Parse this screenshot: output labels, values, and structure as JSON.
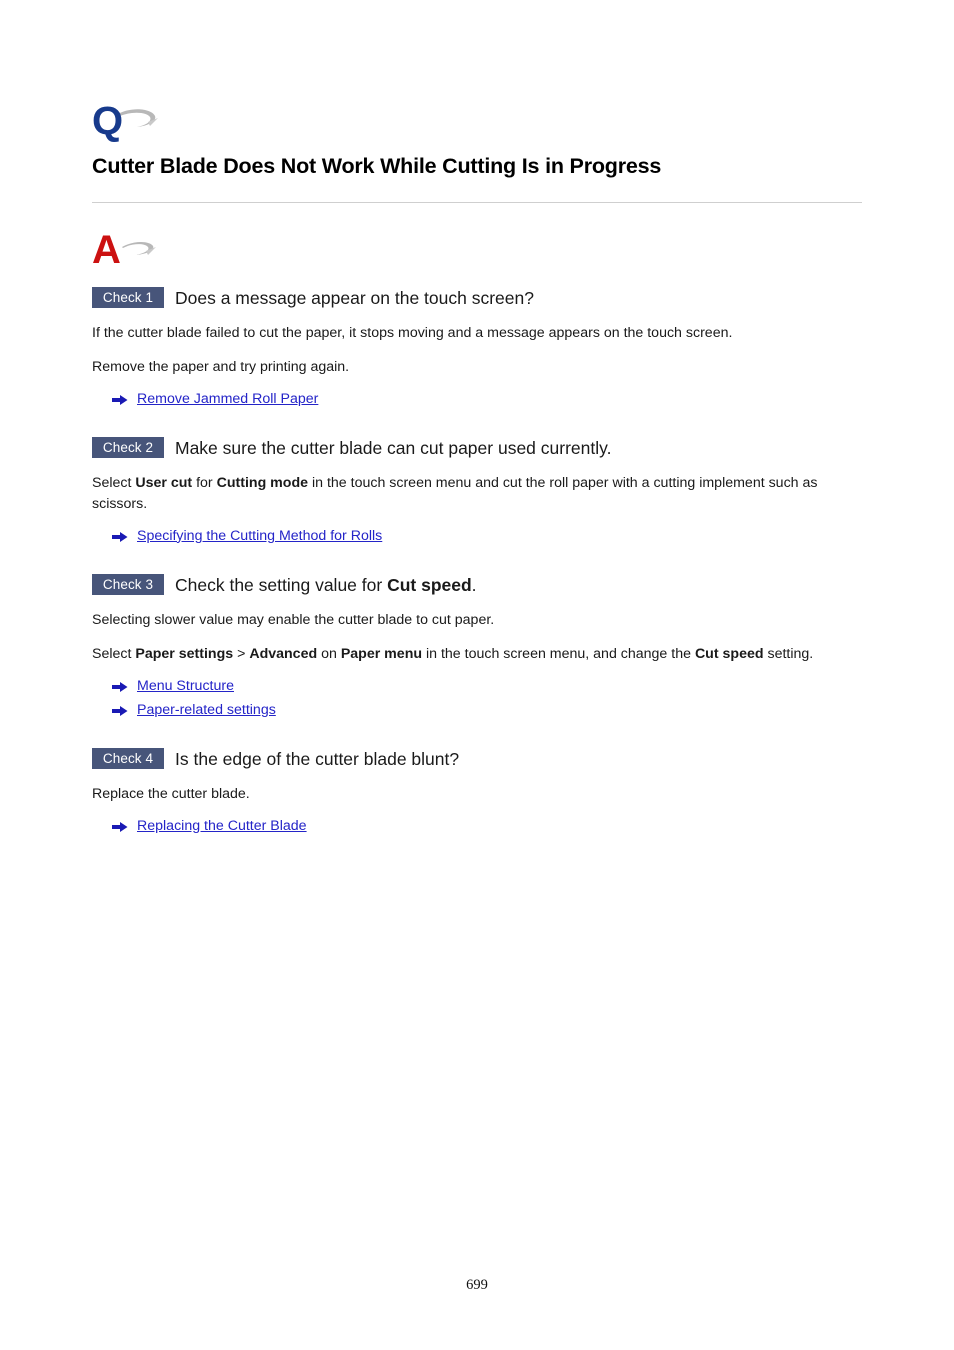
{
  "document": {
    "qa_icon_q": "question-emblem-q",
    "qa_icon_a": "answer-emblem-a",
    "title": "Cutter Blade Does Not Work While Cutting Is in Progress",
    "page_number": "699"
  },
  "colors": {
    "badge_background": "#47557a",
    "badge_text": "#ffffff",
    "link": "#2424c8",
    "q_emblem": "#173a8c",
    "a_emblem": "#cc1111",
    "swoosh": "#b5b5b5",
    "divider": "#cfcfcf"
  },
  "checks": [
    {
      "badge": "Check 1",
      "title_parts": [
        {
          "text": "Does a message appear on the touch screen?",
          "bold": false
        }
      ],
      "paragraphs": [
        [
          {
            "text": "If the cutter blade failed to cut the paper, it stops moving and a message appears on the touch screen.",
            "bold": false
          }
        ],
        [
          {
            "text": "Remove the paper and try printing again.",
            "bold": false
          }
        ]
      ],
      "links": [
        {
          "label": "Remove Jammed Roll Paper",
          "icon": "arrow-right-icon"
        }
      ]
    },
    {
      "badge": "Check 2",
      "title_parts": [
        {
          "text": "Make sure the cutter blade can cut paper used currently.",
          "bold": false
        }
      ],
      "paragraphs": [
        [
          {
            "text": "Select ",
            "bold": false
          },
          {
            "text": "User cut",
            "bold": true
          },
          {
            "text": " for ",
            "bold": false
          },
          {
            "text": "Cutting mode",
            "bold": true
          },
          {
            "text": " in the touch screen menu and cut the roll paper with a cutting implement such as scissors.",
            "bold": false
          }
        ]
      ],
      "links": [
        {
          "label": "Specifying the Cutting Method for Rolls",
          "icon": "arrow-right-icon"
        }
      ]
    },
    {
      "badge": "Check 3",
      "title_parts": [
        {
          "text": "Check the setting value for ",
          "bold": false
        },
        {
          "text": "Cut speed",
          "bold": true
        },
        {
          "text": ".",
          "bold": false
        }
      ],
      "paragraphs": [
        [
          {
            "text": "Selecting slower value may enable the cutter blade to cut paper.",
            "bold": false
          }
        ],
        [
          {
            "text": "Select ",
            "bold": false
          },
          {
            "text": "Paper settings",
            "bold": true
          },
          {
            "text": " > ",
            "bold": false
          },
          {
            "text": "Advanced",
            "bold": true
          },
          {
            "text": " on ",
            "bold": false
          },
          {
            "text": "Paper menu",
            "bold": true
          },
          {
            "text": " in the touch screen menu, and change the ",
            "bold": false
          },
          {
            "text": "Cut speed",
            "bold": true
          },
          {
            "text": " setting.",
            "bold": false
          }
        ]
      ],
      "links": [
        {
          "label": "Menu Structure",
          "icon": "arrow-right-icon"
        },
        {
          "label": "Paper-related settings",
          "icon": "arrow-right-icon"
        }
      ]
    },
    {
      "badge": "Check 4",
      "title_parts": [
        {
          "text": "Is the edge of the cutter blade blunt?",
          "bold": false
        }
      ],
      "paragraphs": [
        [
          {
            "text": "Replace the cutter blade.",
            "bold": false
          }
        ]
      ],
      "links": [
        {
          "label": "Replacing the Cutter Blade",
          "icon": "arrow-right-icon"
        }
      ]
    }
  ]
}
